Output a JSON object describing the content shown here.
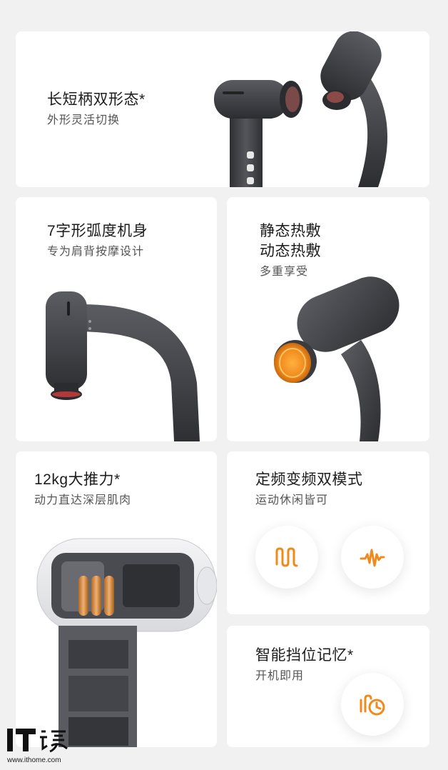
{
  "cards": {
    "shape": {
      "title": "长短柄双形态*",
      "subtitle": "外形灵活切换"
    },
    "curve": {
      "title": "7字形弧度机身",
      "subtitle": "专为肩背按摩设计"
    },
    "heat": {
      "title_line1": "静态热敷",
      "title_line2": "动态热敷",
      "subtitle": "多重享受"
    },
    "thrust": {
      "title": "12kg大推力*",
      "subtitle": "动力直达深层肌肉"
    },
    "modes": {
      "title": "定频变频双模式",
      "subtitle": "运动休闲皆可",
      "items": [
        {
          "icon": "fixed-frequency-wave-icon"
        },
        {
          "icon": "variable-frequency-wave-icon"
        }
      ]
    },
    "memory": {
      "title": "智能挡位记忆*",
      "subtitle": "开机即用",
      "icon": "gear-memory-clock-icon"
    }
  },
  "watermark": {
    "url": "www.ithome.com"
  },
  "colors": {
    "accent": "#f08a1c",
    "device": "#3b3c40",
    "card": "#ffffff",
    "background": "#f1f1f1"
  }
}
